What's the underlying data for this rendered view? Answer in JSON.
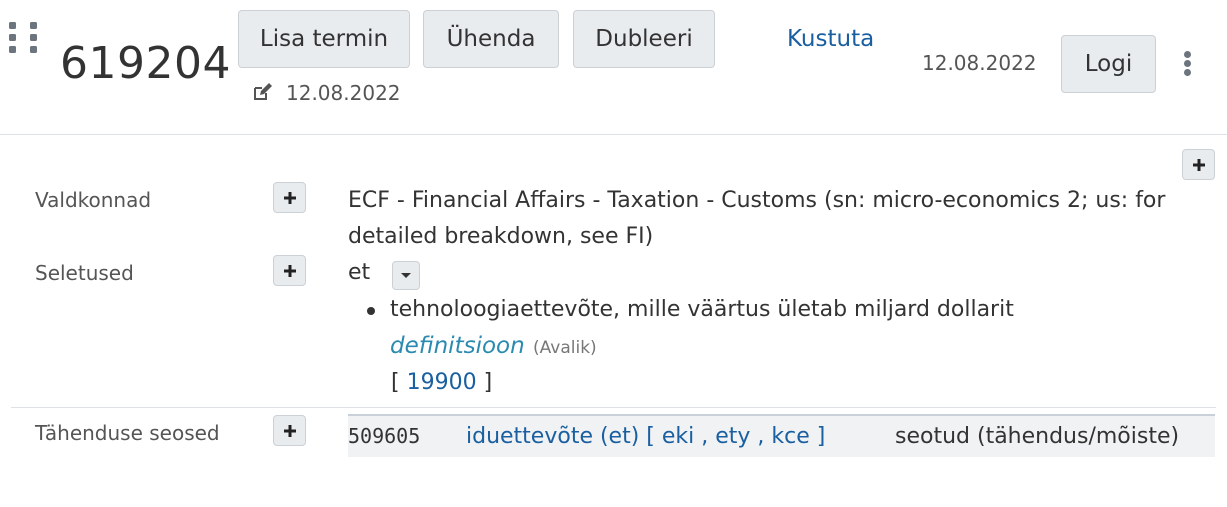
{
  "header": {
    "concept_id": "619204",
    "buttons": {
      "add_term": "Lisa termin",
      "join": "Ühenda",
      "duplicate": "Dubleeri",
      "delete": "Kustuta",
      "log": "Logi"
    },
    "date_right": "12.08.2022",
    "edit_date": "12.08.2022"
  },
  "rows": {
    "domains": {
      "label": "Valdkonnad",
      "value": "ECF - Financial Affairs - Taxation - Customs (sn: micro-economics 2; us: for detailed breakdown, see FI)"
    },
    "definitions": {
      "label": "Seletused",
      "lang": "et",
      "items": [
        {
          "text": "tehnoloogiaettevõte, mille väärtus ületab miljard dollarit",
          "type": "definitsioon",
          "visibility": "(Avalik)",
          "source_open": "[ ",
          "source": "19900",
          "source_close": " ]"
        }
      ]
    },
    "relations": {
      "label": "Tähenduse seosed",
      "items": [
        {
          "id": "509605",
          "term": "iduettevõte (et) [ eki , ety , kce ]",
          "relation_type": "seotud (tähendus/mõiste)"
        }
      ]
    }
  },
  "colors": {
    "link": "#1a5fa0",
    "definition_type": "#2a8ab0",
    "button_bg": "#e9ecef"
  },
  "icons": {
    "drag": "drag-handle-icon",
    "edit": "edit-icon",
    "menu": "kebab-menu-icon",
    "add": "plus-icon",
    "toggle": "caret-down-icon"
  }
}
